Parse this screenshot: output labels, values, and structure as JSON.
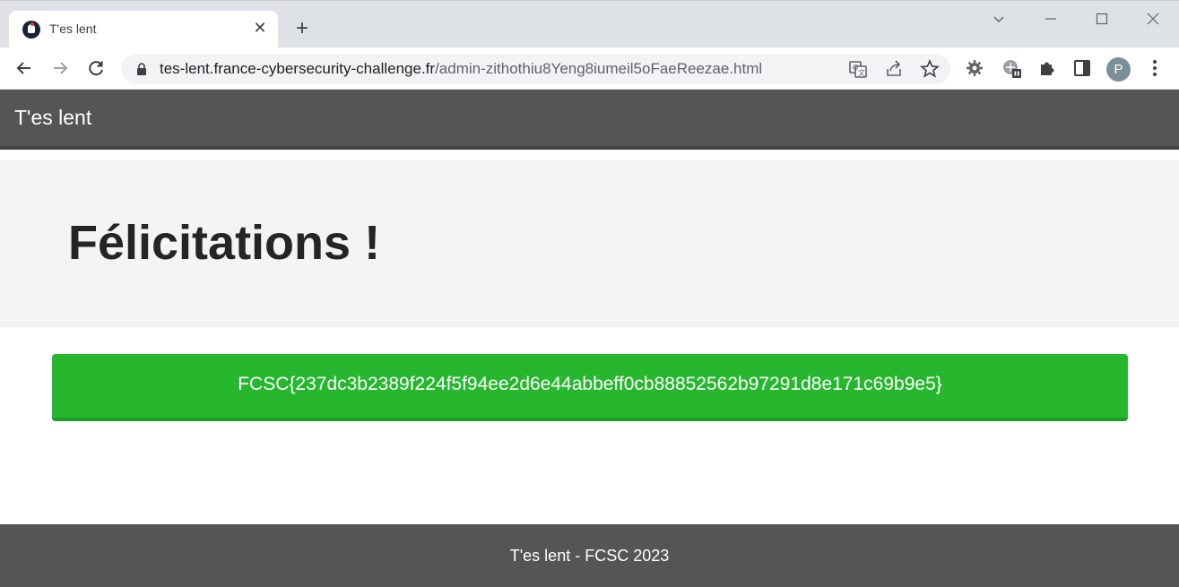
{
  "browser": {
    "tab_title": "T'es lent",
    "url_host": "tes-lent.france-cybersecurity-challenge.fr",
    "url_path": "/admin-zithothiu8Yeng8iumeil5oFaeReezae.html",
    "profile_initial": "P"
  },
  "page": {
    "brand": "T'es lent",
    "heading": "Félicitations !",
    "flag": "FCSC{237dc3b2389f224f5f94ee2d6e44abbeff0cb88852562b97291d8e171c69b9e5}",
    "footer": "T'es lent - FCSC 2023"
  },
  "colors": {
    "navbar": "#555555",
    "hero": "#f4f4f4",
    "success": "#26b72f"
  }
}
